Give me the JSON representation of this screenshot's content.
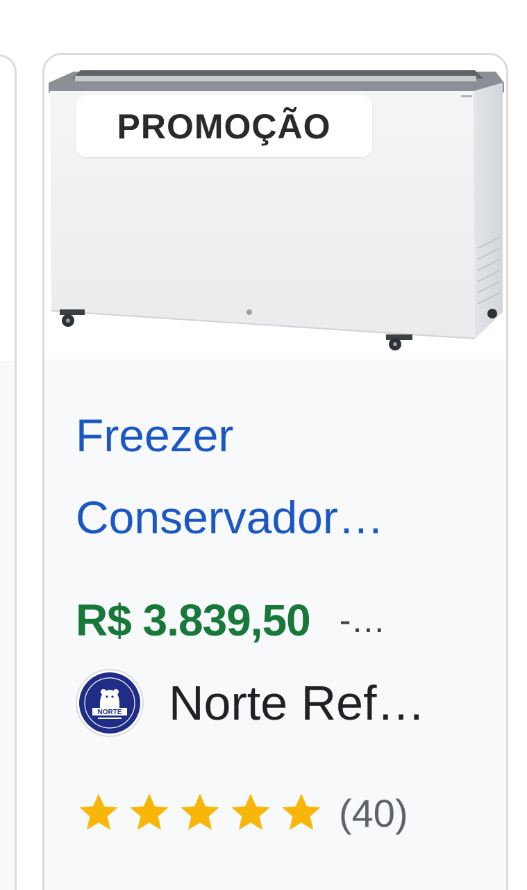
{
  "badge": {
    "label": "PROMOÇÃO"
  },
  "product": {
    "title_line1": "Freezer",
    "title_line2": "Conservador…",
    "price": "R$ 3.839,50",
    "price_extra": "-…",
    "image_icon": "chest-freezer-image"
  },
  "seller": {
    "name": "Norte Ref…",
    "logo_text": "NORTE",
    "logo_icon": "norte-seller-logo"
  },
  "rating": {
    "stars": 5,
    "max_stars": 5,
    "count": "(40)"
  },
  "colors": {
    "title": "#1a57c4",
    "price": "#17783a",
    "star": "#f9b60a",
    "card_border": "#dadce0",
    "card_bg": "#f8f9fa",
    "logo_bg": "#1f2d86"
  }
}
